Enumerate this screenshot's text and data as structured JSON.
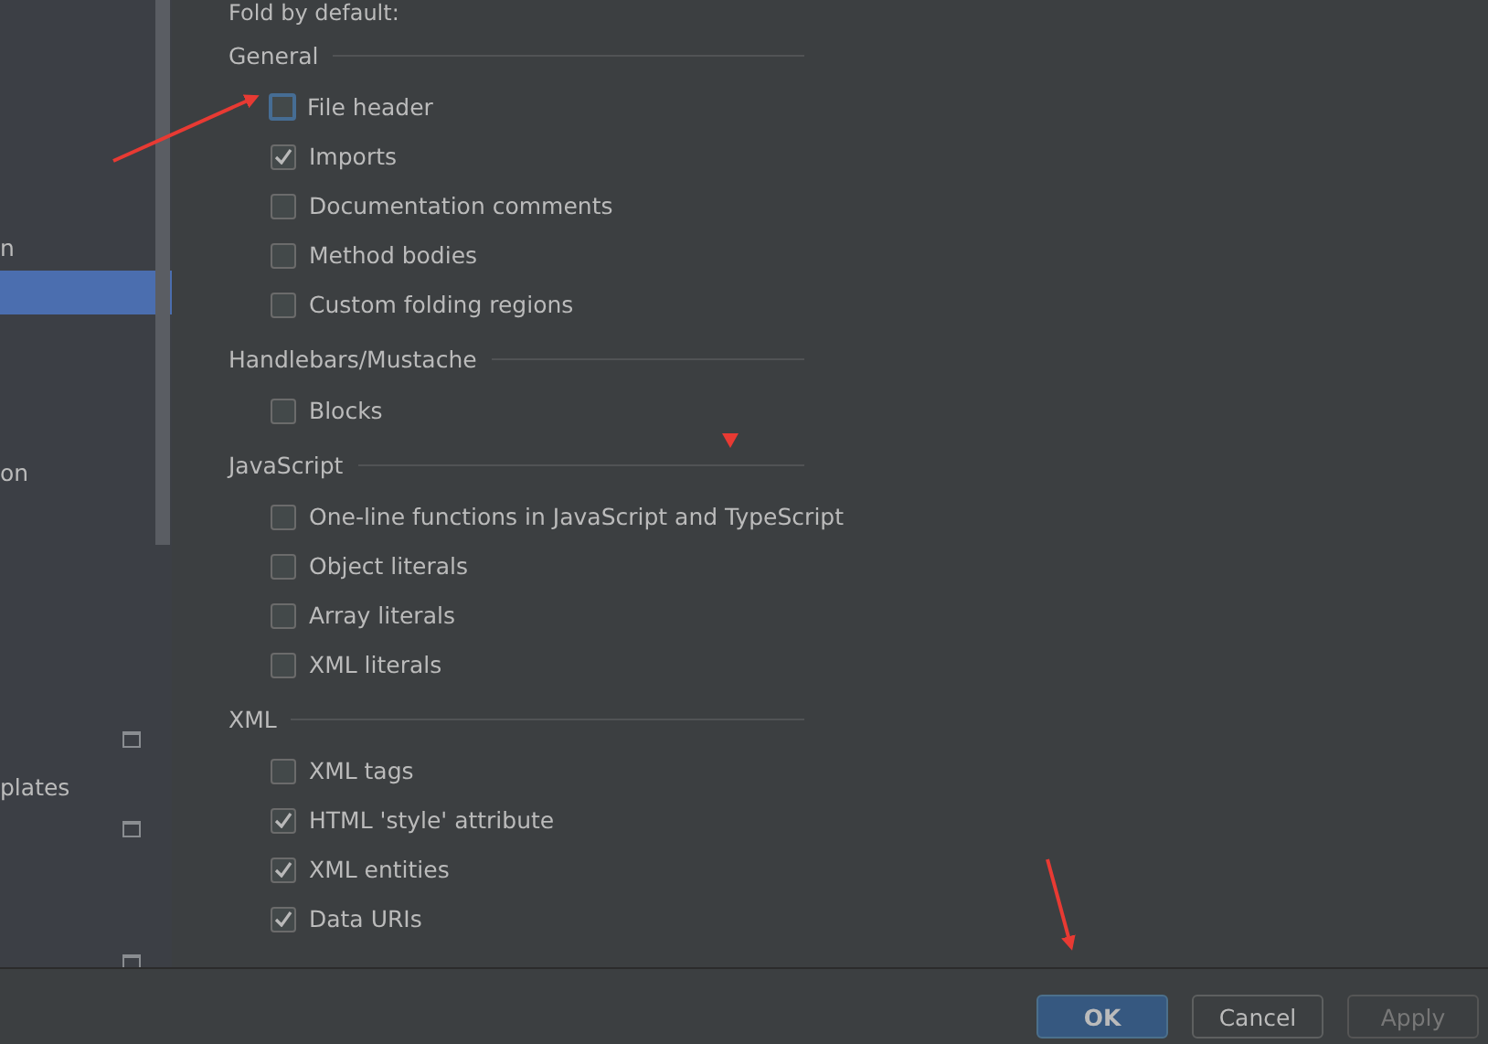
{
  "sidebar": {
    "items": [
      {
        "selected": false
      },
      {
        "selected": false
      },
      {
        "selected": false
      },
      {
        "selected": false
      },
      {
        "selected": false
      },
      {
        "label": "n",
        "selected": false
      },
      {
        "selected": true
      },
      {
        "selected": false
      },
      {
        "selected": false
      },
      {
        "selected": false
      },
      {
        "label": "on",
        "selected": false
      },
      {
        "selected": false
      },
      {
        "selected": false
      },
      {
        "selected": false
      },
      {
        "selected": false
      },
      {
        "selected": false
      },
      {
        "selected": false,
        "icon": true
      },
      {
        "label": "plates",
        "selected": false
      },
      {
        "selected": false,
        "icon": true
      },
      {
        "selected": false
      },
      {
        "selected": false
      },
      {
        "selected": false,
        "icon": true
      }
    ]
  },
  "panel": {
    "title": "Fold by default:",
    "sections": [
      {
        "heading": "General",
        "options": [
          {
            "label": "File header",
            "checked": false,
            "focused": true
          },
          {
            "label": "Imports",
            "checked": true
          },
          {
            "label": "Documentation comments",
            "checked": false
          },
          {
            "label": "Method bodies",
            "checked": false
          },
          {
            "label": "Custom folding regions",
            "checked": false
          }
        ]
      },
      {
        "heading": "Handlebars/Mustache",
        "options": [
          {
            "label": "Blocks",
            "checked": false
          }
        ]
      },
      {
        "heading": "JavaScript",
        "options": [
          {
            "label": "One-line functions in JavaScript and TypeScript",
            "checked": false
          },
          {
            "label": "Object literals",
            "checked": false
          },
          {
            "label": "Array literals",
            "checked": false
          },
          {
            "label": "XML literals",
            "checked": false
          }
        ]
      },
      {
        "heading": "XML",
        "options": [
          {
            "label": "XML tags",
            "checked": false
          },
          {
            "label": "HTML 'style' attribute",
            "checked": true
          },
          {
            "label": "XML entities",
            "checked": true
          },
          {
            "label": "Data URIs",
            "checked": true
          }
        ]
      }
    ]
  },
  "buttons": [
    {
      "label": "OK",
      "kind": "default",
      "disabled": false
    },
    {
      "label": "Cancel",
      "kind": "normal",
      "disabled": false
    },
    {
      "label": "Apply",
      "kind": "normal",
      "disabled": true
    }
  ]
}
